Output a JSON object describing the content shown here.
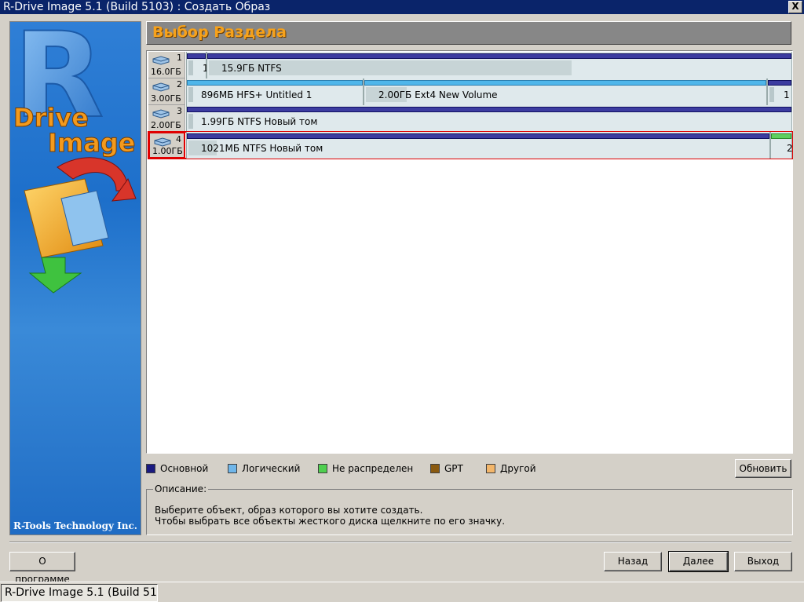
{
  "window": {
    "title": "R-Drive Image 5.1 (Build 5103) : Создать Образ",
    "close_glyph": "X"
  },
  "banner": {
    "logo_letter": "R",
    "logo_word1": "Drive",
    "logo_word2": "Image",
    "company": "R-Tools Technology Inc."
  },
  "header": {
    "title": "Выбор Раздела"
  },
  "disks": [
    {
      "number": "1",
      "size": "16.0ГБ",
      "selected": false,
      "partitions": [
        {
          "kind": "primary",
          "label": "1",
          "used": 0.1
        },
        {
          "kind": "primary",
          "label": "15.9ГБ  NTFS",
          "used": 0.62
        }
      ]
    },
    {
      "number": "2",
      "size": "3.00ГБ",
      "selected": false,
      "partitions": [
        {
          "kind": "logical",
          "label": "896МБ  HFS+  Untitled 1",
          "used": 0.02
        },
        {
          "kind": "logical",
          "label": "2.00ГБ  Ext4  New Volume",
          "used": 0.16
        },
        {
          "kind": "primary",
          "label": "1",
          "used": 0.2
        }
      ]
    },
    {
      "number": "3",
      "size": "2.00ГБ",
      "selected": false,
      "partitions": [
        {
          "kind": "primary",
          "label": "1.99ГБ  NTFS  Новый том",
          "used": 0.01
        }
      ]
    },
    {
      "number": "4",
      "size": "1.00ГБ",
      "selected": true,
      "partitions": [
        {
          "kind": "primary",
          "label": "1021МБ  NTFS  Новый том",
          "used": 0.05
        },
        {
          "kind": "unalloc",
          "label": "2",
          "used": 0.0
        }
      ]
    }
  ],
  "legend": {
    "primary": "Основной",
    "logical": "Логический",
    "unallocated": "Не распределен",
    "gpt": "GPT",
    "other": "Другой"
  },
  "colors": {
    "primary": "#1a1a80",
    "logical": "#6fb6ea",
    "unallocated": "#4fcf4f",
    "gpt": "#8a5a10",
    "other": "#f3b66a",
    "header_text": "#f7a21b",
    "selection": "#e00000"
  },
  "buttons": {
    "refresh": "Обновить",
    "about": "О программе",
    "back": "Назад",
    "next": "Далее",
    "exit": "Выход"
  },
  "description": {
    "title": "Описание:",
    "line1": "Выберите объект, образ которого вы хотите создать.",
    "line2": "Чтобы выбрать все объекты жесткого диска щелкните по его значку."
  },
  "taskbar": {
    "item": "R-Drive Image 5.1 (Build 51..."
  }
}
